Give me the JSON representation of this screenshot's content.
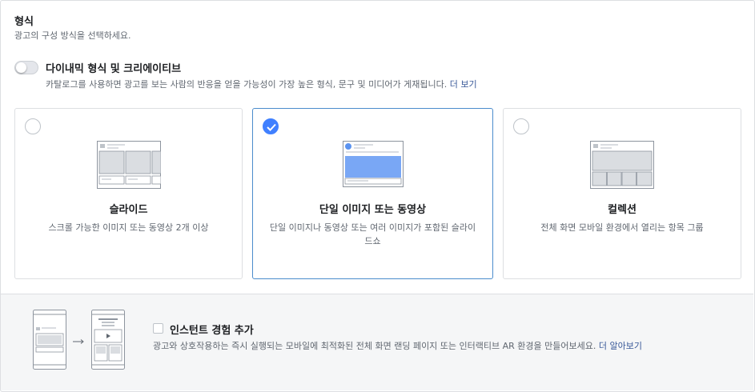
{
  "format": {
    "title": "형식",
    "subtitle": "광고의 구성 방식을 선택하세요."
  },
  "dynamic": {
    "enabled": false,
    "title": "다이내믹 형식 및 크리에이티브",
    "description": "카탈로그를 사용하면 광고를 보는 사람의 반응을 얻을 가능성이 가장 높은 형식, 문구 및 미디어가 게재됩니다.",
    "link": "더 보기"
  },
  "cards": [
    {
      "title": "슬라이드",
      "description": "스크롤 가능한 이미지 또는 동영상 2개 이상",
      "selected": false,
      "icon": "carousel-icon"
    },
    {
      "title": "단일 이미지 또는 동영상",
      "description": "단일 이미지나 동영상 또는 여러 이미지가 포함된 슬라이드쇼",
      "selected": true,
      "icon": "single-image-icon"
    },
    {
      "title": "컬렉션",
      "description": "전체 화면 모바일 환경에서 열리는 항목 그룹",
      "selected": false,
      "icon": "collection-icon"
    }
  ],
  "instant_experience": {
    "checked": false,
    "title": "인스턴트 경험 추가",
    "description": "광고와 상호작용하는 즉시 실행되는 모바일에 최적화된 전체 화면 랜딩 페이지 또는 인터랙티브 AR 환경을 만들어보세요.",
    "link": "더 알아보기",
    "icon": "instant-experience-icon"
  },
  "colors": {
    "accent": "#4080ff",
    "link": "#385898",
    "selected_border": "#4b8ccc"
  }
}
